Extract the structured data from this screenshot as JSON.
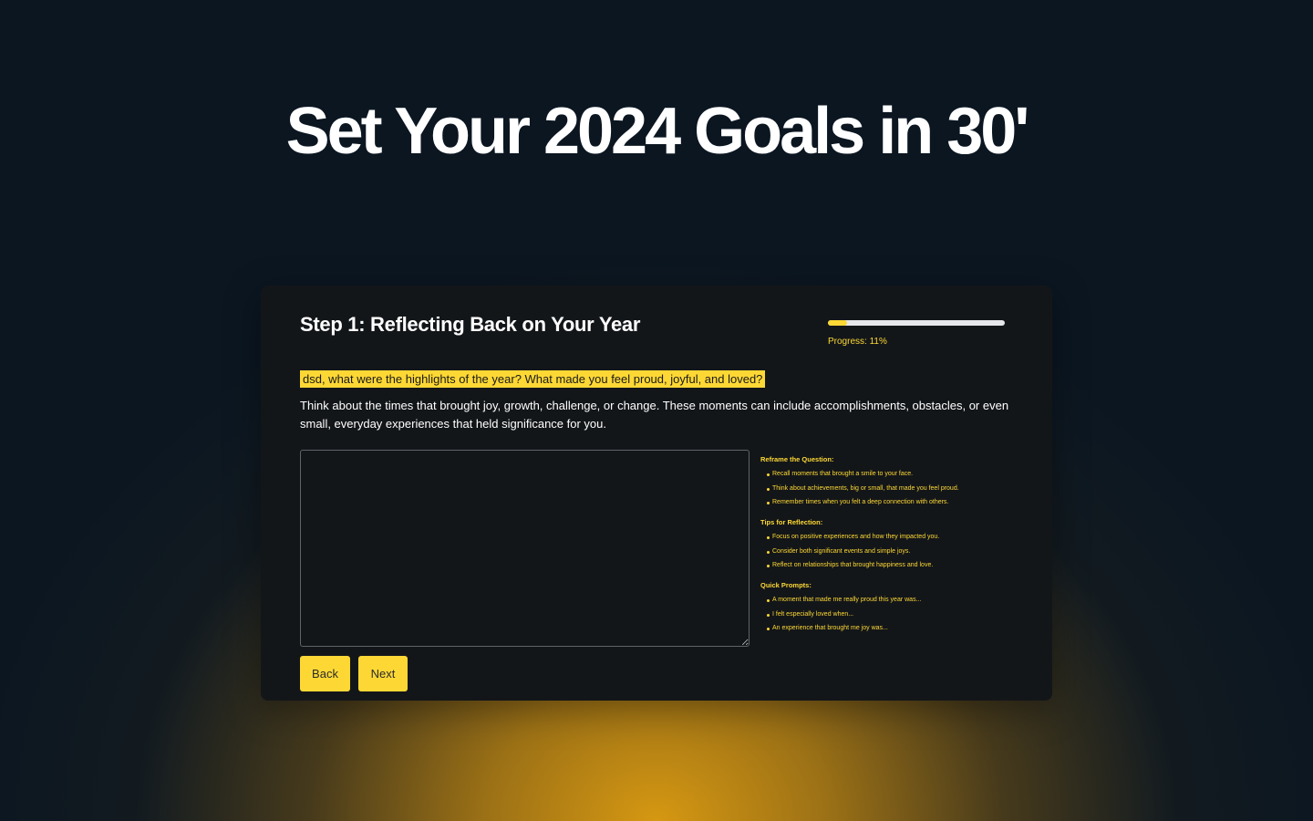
{
  "hero": {
    "title": "Set Your 2024 Goals in 30'"
  },
  "step": {
    "title": "Step 1: Reflecting Back on Your Year",
    "progress_label": "Progress: 11%",
    "progress_percent": 11,
    "question": "dsd, what were the highlights of the year? What made you feel proud, joyful, and loved?",
    "description": "Think about the times that brought joy, growth, challenge, or change. These moments can include accomplishments, obstacles, or even small, everyday experiences that held significance for you.",
    "answer_value": ""
  },
  "tips": {
    "sections": [
      {
        "heading": "Reframe the Question:",
        "items": [
          "Recall moments that brought a smile to your face.",
          "Think about achievements, big or small, that made you feel proud.",
          "Remember times when you felt a deep connection with others."
        ]
      },
      {
        "heading": "Tips for Reflection:",
        "items": [
          "Focus on positive experiences and how they impacted you.",
          "Consider both significant events and simple joys.",
          "Reflect on relationships that brought happiness and love."
        ]
      },
      {
        "heading": "Quick Prompts:",
        "items": [
          "A moment that made me really proud this year was...",
          "I felt especially loved when...",
          "An experience that brought me joy was..."
        ]
      }
    ]
  },
  "actions": {
    "back_label": "Back",
    "next_label": "Next"
  },
  "colors": {
    "accent": "#fdd835",
    "card_background": "#131619",
    "page_background": "#0b1621",
    "glow": "#d69812"
  }
}
